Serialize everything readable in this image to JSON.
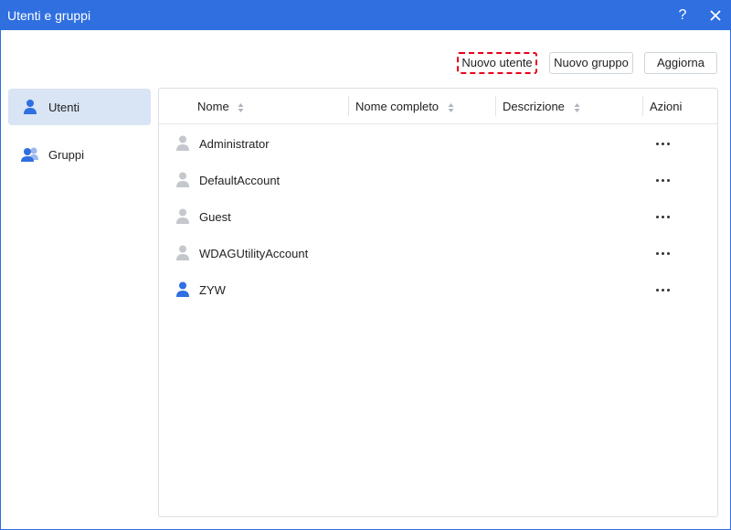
{
  "window": {
    "title": "Utenti e gruppi",
    "help_label": "?"
  },
  "toolbar": {
    "new_user_label": "Nuovo utente",
    "new_group_label": "Nuovo gruppo",
    "refresh_label": "Aggiorna"
  },
  "sidebar": {
    "items": [
      {
        "label": "Utenti",
        "icon": "user-icon",
        "active": true
      },
      {
        "label": "Gruppi",
        "icon": "group-icon",
        "active": false
      }
    ]
  },
  "table": {
    "columns": [
      "Nome",
      "Nome completo",
      "Descrizione",
      "Azioni"
    ],
    "rows": [
      {
        "name": "Administrator",
        "full_name": "",
        "description": "",
        "icon": "user-icon",
        "status": "disabled"
      },
      {
        "name": "DefaultAccount",
        "full_name": "",
        "description": "",
        "icon": "user-icon",
        "status": "disabled"
      },
      {
        "name": "Guest",
        "full_name": "",
        "description": "",
        "icon": "user-icon",
        "status": "disabled"
      },
      {
        "name": "WDAGUtilityAccount",
        "full_name": "",
        "description": "",
        "icon": "user-icon",
        "status": "disabled"
      },
      {
        "name": "ZYW",
        "full_name": "",
        "description": "",
        "icon": "user-icon",
        "status": "active"
      }
    ]
  },
  "colors": {
    "accent": "#2f6fe0",
    "selected_bg": "#d9e4f5",
    "disabled_icon": "#c4c7cc",
    "highlight_border": "#e8001c"
  }
}
